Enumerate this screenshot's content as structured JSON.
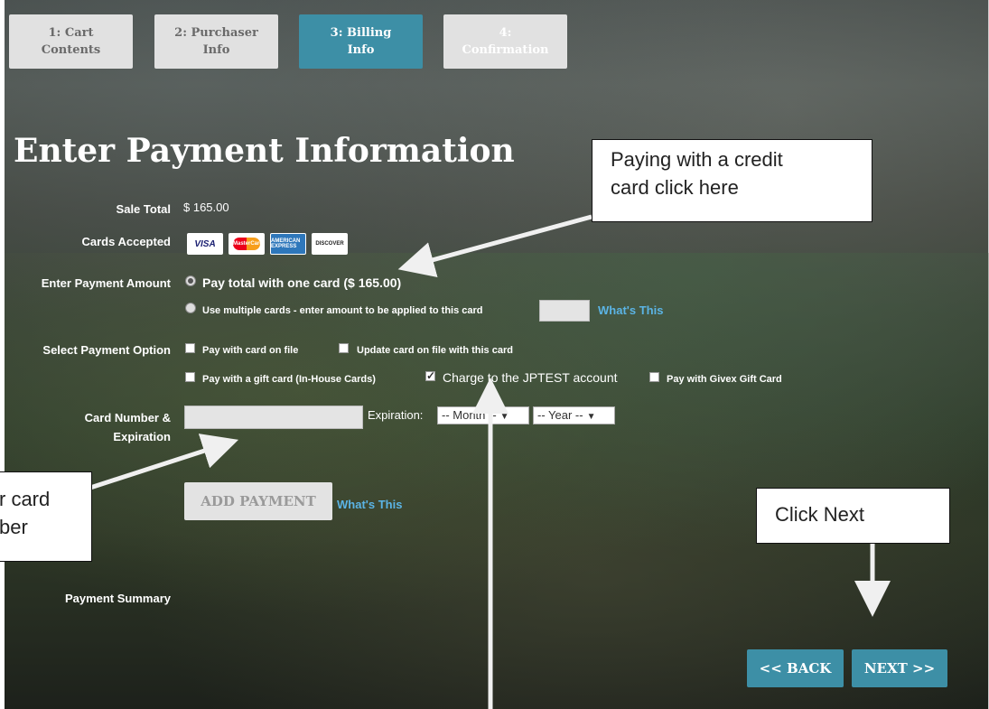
{
  "steps": [
    {
      "label": "1: Cart Contents",
      "line1": "1: Cart",
      "line2": "Contents"
    },
    {
      "label": "2: Purchaser Info",
      "line1": "2: Purchaser",
      "line2": "Info"
    },
    {
      "label": "3: Billing Info",
      "line1": "3: Billing",
      "line2": "Info"
    },
    {
      "label": "4: Confirmation",
      "line1": "4:",
      "line2": "Confirmation"
    }
  ],
  "page_title": "Enter Payment Information",
  "form": {
    "sale_total_label": "Sale Total",
    "sale_total_value": "$ 165.00",
    "cards_accepted_label": "Cards Accepted",
    "cards": [
      "VISA",
      "MasterCard",
      "AMERICAN EXPRESS",
      "DISCOVER"
    ],
    "payment_amount_label": "Enter Payment Amount",
    "option_pay_total": "Pay total with one card ($ 165.00)",
    "option_multiple": "Use multiple cards - enter amount to be applied to this card",
    "whats_this": "What's This",
    "payment_option_label": "Select Payment Option",
    "opt_card_on_file": "Pay with card on file",
    "opt_update_card": "Update card on file with this card",
    "opt_gift_card": "Pay with a gift card (In-House Cards)",
    "opt_charge_account": "Charge to the JPTEST account",
    "opt_givex": "Pay with Givex Gift Card",
    "card_number_label_1": "Card Number &",
    "card_number_label_2": "Expiration",
    "expiration_label": "Expiration:",
    "month_select": "-- Month --",
    "year_select": "-- Year --",
    "add_payment": "ADD PAYMENT",
    "payment_summary_label": "Payment Summary"
  },
  "nav": {
    "back": "<< BACK",
    "next": "NEXT >>"
  },
  "callouts": {
    "credit_card_line1": "Paying with a credit",
    "credit_card_line2": "card click here",
    "card_number_line1": "r card",
    "card_number_line2": "ber",
    "click_next": "Click Next"
  },
  "colors": {
    "accent": "#3d8fa6",
    "link": "#5bb4e5"
  }
}
